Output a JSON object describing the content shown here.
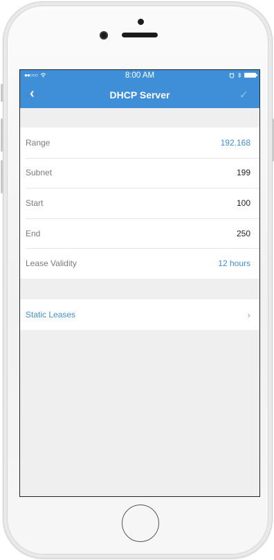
{
  "status_bar": {
    "signal": "●●○○○",
    "wifi_icon": "wifi-icon",
    "time": "8:00 AM",
    "alarm_icon": "alarm-icon",
    "bluetooth_icon": "bluetooth-icon"
  },
  "nav": {
    "back": "‹",
    "title": "DHCP Server",
    "done": "✓"
  },
  "settings": [
    {
      "label": "Range",
      "value": "192.168",
      "value_color": "#3e8fd8"
    },
    {
      "label": "Subnet",
      "value": "199"
    },
    {
      "label": "Start",
      "value": "100"
    },
    {
      "label": "End",
      "value": "250"
    },
    {
      "label": "Lease Validity",
      "value": "12 hours",
      "value_color": "#3e8fd8"
    }
  ],
  "static_leases": {
    "label": "Static Leases",
    "chevron": "›"
  },
  "colors": {
    "accent": "#3e8fd8",
    "background": "#efefef"
  }
}
